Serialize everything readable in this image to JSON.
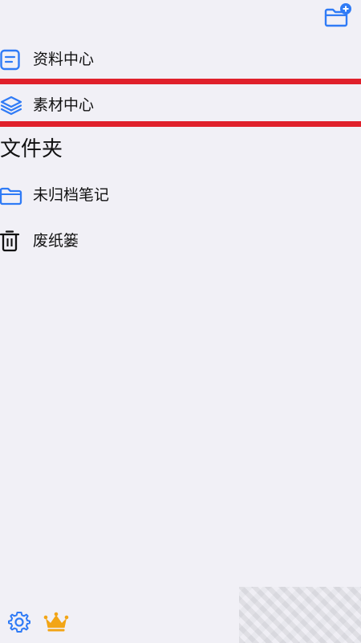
{
  "header": {
    "new_folder_icon": "folder-plus-icon"
  },
  "nav": {
    "items": [
      {
        "label": "资料中心",
        "icon": "document-list-icon"
      },
      {
        "label": "素材中心",
        "icon": "layers-icon"
      }
    ]
  },
  "folders": {
    "title": "文件夹",
    "items": [
      {
        "label": "未归档笔记",
        "icon": "folder-icon"
      },
      {
        "label": "废纸篓",
        "icon": "trash-icon"
      }
    ]
  },
  "footer": {
    "settings_icon": "gear-icon",
    "premium_icon": "crown-icon"
  },
  "colors": {
    "accent": "#2f7bf6",
    "highlight": "#e0202b",
    "crown": "#f2a516",
    "background": "#f1f0f6"
  }
}
